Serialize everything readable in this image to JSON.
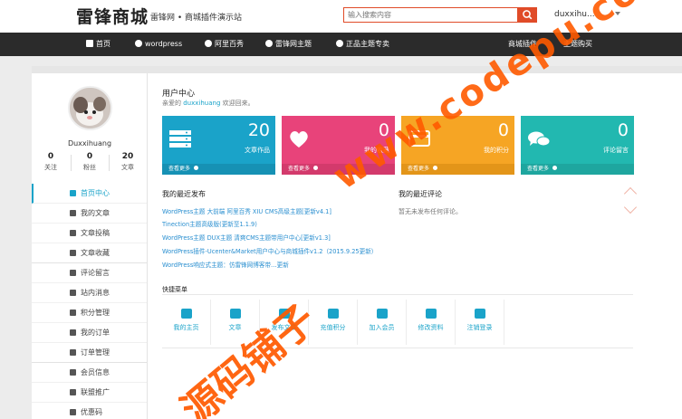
{
  "header": {
    "logo": "雷锋商城",
    "tagline": "雷锋网 • 商城插件演示站",
    "search_placeholder": "输入搜索内容",
    "user": "duxxihu..."
  },
  "nav": {
    "items": [
      {
        "label": "首页"
      },
      {
        "label": "wordpress"
      },
      {
        "label": "阿里百秀"
      },
      {
        "label": "雷锋网主题"
      },
      {
        "label": "正品主题专卖"
      },
      {
        "label": "商城插件"
      },
      {
        "label": "主题购买"
      }
    ]
  },
  "sidebar": {
    "username": "Duxxihuang",
    "stats": [
      {
        "num": "0",
        "label": "关注"
      },
      {
        "num": "0",
        "label": "粉丝"
      },
      {
        "num": "20",
        "label": "文章"
      }
    ],
    "menu": [
      {
        "label": "首页中心"
      },
      {
        "label": "我的文章"
      },
      {
        "label": "文章投稿"
      },
      {
        "label": "文章收藏"
      },
      {
        "label": "评论留言"
      },
      {
        "label": "站内消息"
      },
      {
        "label": "积分管理"
      },
      {
        "label": "我的订单"
      },
      {
        "label": "订单管理"
      },
      {
        "label": "会员信息"
      },
      {
        "label": "联盟推广"
      },
      {
        "label": "优惠码"
      }
    ]
  },
  "content": {
    "title": "用户中心",
    "welcome_prefix": "亲爱的",
    "welcome_user": "duxxihuang",
    "welcome_suffix": "欢迎回来。",
    "tiles": [
      {
        "num": "20",
        "label": "文章作品",
        "foot": "查看更多",
        "color": "#1aa3c9"
      },
      {
        "num": "0",
        "label": "我的收藏",
        "foot": "查看更多",
        "color": "#e8437a"
      },
      {
        "num": "0",
        "label": "我的积分",
        "foot": "查看更多",
        "color": "#f6a524"
      },
      {
        "num": "0",
        "label": "评论留言",
        "foot": "查看更多",
        "color": "#22b8b0"
      }
    ],
    "recent_posts_title": "我的最近发布",
    "recent_posts": [
      "WordPress主题 大前端 阿里百秀 XIU CMS高级主题[更新v4.1]",
      "Tinection主题高级版(更新至1.1.9)",
      "WordPress主题 DUX主题 清爽CMS主题带用户中心[更新v1.3]",
      "WordPress插件-Ucenter&Market用户中心与商城插件v1.2（2015.9.25更新）",
      "WordPress响应式主题：仿雷锋网博客带…更新"
    ],
    "recent_comments_title": "我的最近评论",
    "no_comments": "暂无未发布任何评论。",
    "quick_menu_title": "快捷菜单",
    "quick_menu": [
      {
        "label": "我的主页"
      },
      {
        "label": "文章"
      },
      {
        "label": "发布文章"
      },
      {
        "label": "充值积分"
      },
      {
        "label": "加入会员"
      },
      {
        "label": "修改资料"
      },
      {
        "label": "注销登录"
      }
    ]
  },
  "watermark": {
    "url": "www.codepu.com",
    "cn": "源码铺子"
  }
}
